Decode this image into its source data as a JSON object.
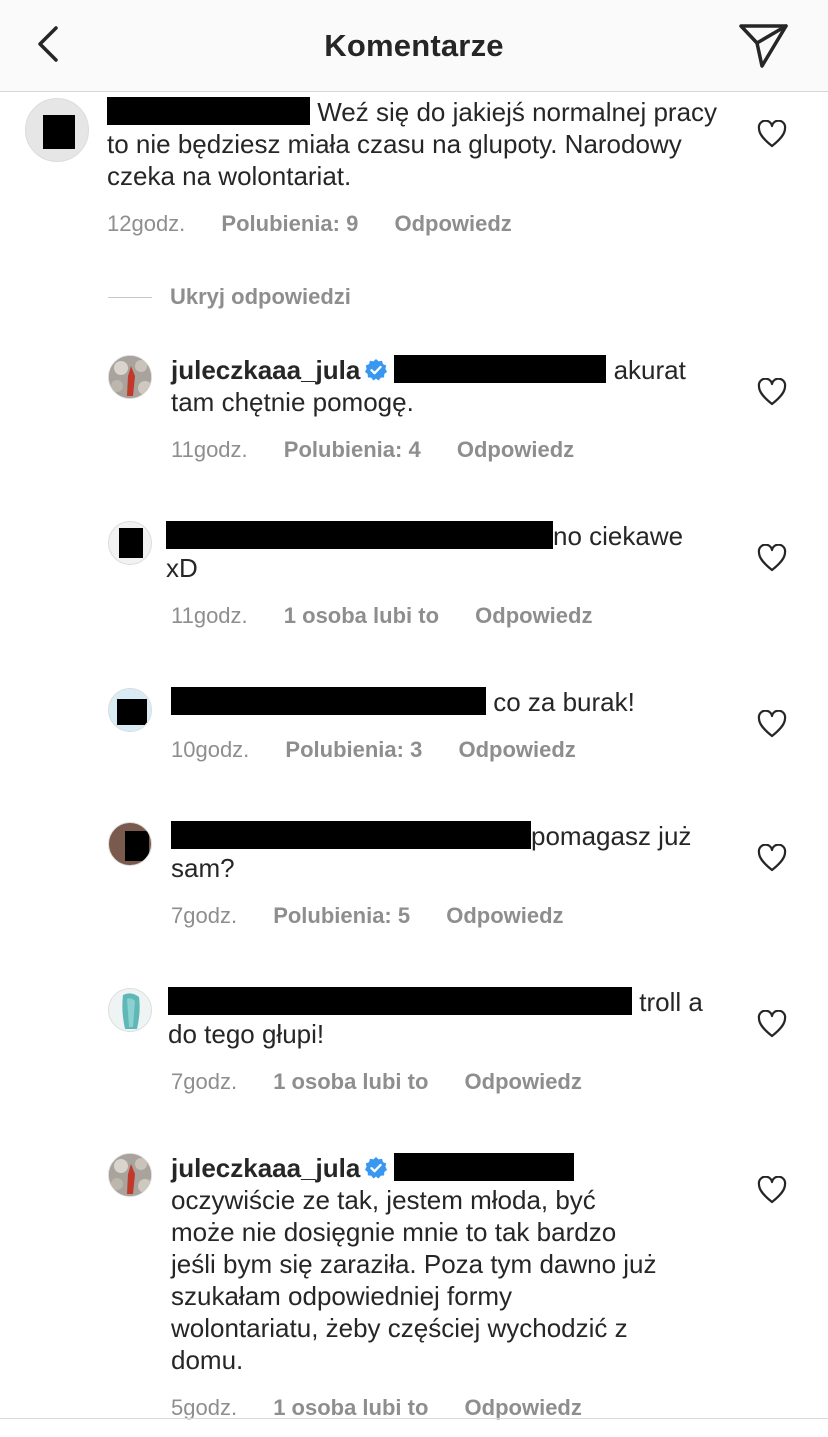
{
  "header": {
    "title": "Komentarze"
  },
  "main_comment": {
    "text": "Weź się do jakiejś normalnej pracy to nie będziesz miała czasu na glupoty. Narodowy czeka na wolontariat.",
    "time": "12godz.",
    "likes": "Polubienia: 9",
    "reply": "Odpowiedz"
  },
  "hide_replies_label": "Ukryj odpowiedzi",
  "replies": [
    {
      "username": "juleczkaaa_jula",
      "text": "akurat tam chętnie pomogę.",
      "time": "11godz.",
      "likes": "Polubienia: 4",
      "reply": "Odpowiedz"
    },
    {
      "text_after": "no ciekawe",
      "text_line2": "xD",
      "time": "11godz.",
      "likes": "1 osoba lubi to",
      "reply": "Odpowiedz"
    },
    {
      "text_after": "co za burak!",
      "time": "10godz.",
      "likes": "Polubienia: 3",
      "reply": "Odpowiedz"
    },
    {
      "text_after": "pomagasz już",
      "text_line2": "sam?",
      "time": "7godz.",
      "likes": "Polubienia: 5",
      "reply": "Odpowiedz"
    },
    {
      "text_after": "troll a",
      "text_line2": "do tego głupi!",
      "time": "7godz.",
      "likes": "1 osoba lubi to",
      "reply": "Odpowiedz"
    },
    {
      "username": "juleczkaaa_jula",
      "lines": [
        "oczywiście ze tak, jestem młoda, być",
        "może nie dosięgnie mnie to tak bardzo",
        "jeśli bym się zaraziła. Poza tym dawno już",
        "szukałam odpowiedniej formy",
        "wolontariatu, żeby częściej wychodzić z",
        "domu."
      ],
      "time": "5godz.",
      "likes": "1 osoba lubi to",
      "reply": "Odpowiedz"
    }
  ],
  "colors": {
    "text": "#262626",
    "meta": "#8e8e8e",
    "verified": "#3897f0",
    "redaction": "#000000"
  }
}
